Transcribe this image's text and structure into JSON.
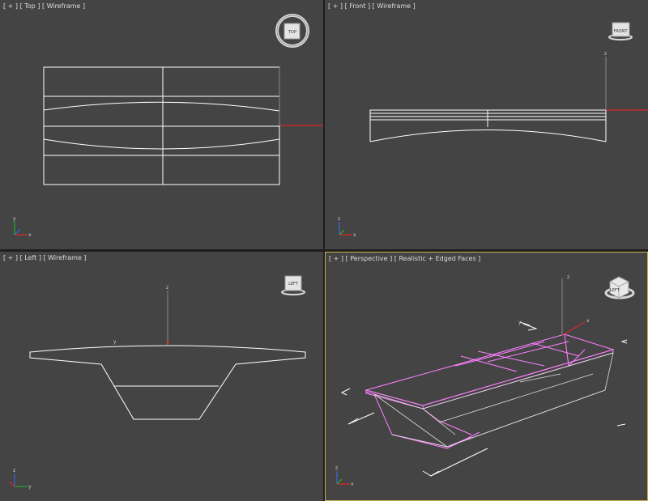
{
  "viewports": {
    "top": {
      "label": "[ + ] [ Top ] [ Wireframe ]",
      "cube_label": "TOP"
    },
    "front": {
      "label": "[ + ] [ Front ] [ Wireframe ]",
      "cube_label": "FRONT"
    },
    "left": {
      "label": "[ + ] [ Left ] [ Wireframe ]",
      "cube_label": "LEFT"
    },
    "perspective": {
      "label": "[ + ] [ Perspective ] [ Realistic + Edged Faces ]",
      "cube_label": "LEFT"
    }
  },
  "axis_letters": {
    "x": "x",
    "y": "y",
    "z": "z"
  },
  "colors": {
    "viewport_bg": "#444444",
    "wire": "#ffffff",
    "selected_wire": "#ff80ff",
    "active_border": "#c9b14a",
    "x_axis": "#ff2020",
    "y_axis": "#20c020",
    "z_axis": "#3070ff"
  }
}
